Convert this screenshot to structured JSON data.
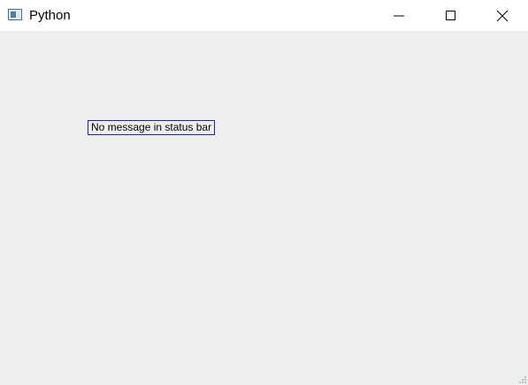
{
  "window": {
    "title": "Python",
    "icon": "python-window-icon"
  },
  "caption_buttons": {
    "minimize": "minimize-icon",
    "maximize": "maximize-icon",
    "close": "close-icon"
  },
  "main": {
    "status_label": "No message in status bar"
  },
  "colors": {
    "client_background": "#efefef",
    "titlebar_background": "#ffffff",
    "label_border": "#1c1cc8"
  }
}
